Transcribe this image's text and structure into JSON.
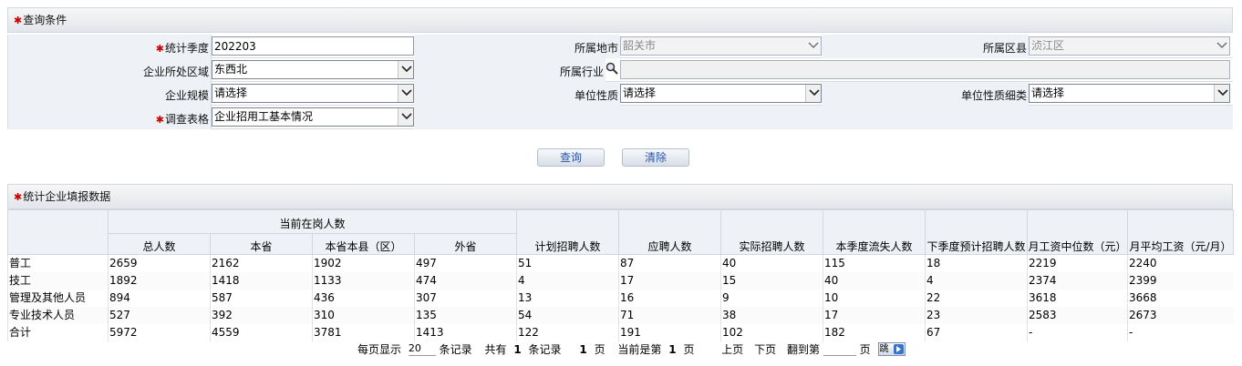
{
  "query": {
    "header": "查询条件",
    "season_label": "统计季度",
    "season_value": "202203",
    "city_label": "所属地市",
    "city_value": "韶关市",
    "county_label": "所属区县",
    "county_value": "浈江区",
    "region_label": "企业所处区域",
    "region_value": "东西北",
    "industry_label": "所属行业",
    "scale_label": "企业规模",
    "scale_value": "请选择",
    "nature_label": "单位性质",
    "nature_value": "请选择",
    "nature_detail_label": "单位性质细类",
    "nature_detail_value": "请选择",
    "survey_label": "调查表格",
    "survey_value": "企业招用工基本情况"
  },
  "buttons": {
    "query": "查询",
    "clear": "清除"
  },
  "results": {
    "header": "统计企业填报数据",
    "group_header": "当前在岗人数",
    "columns": [
      "总人数",
      "本省",
      "本省本县（区）",
      "外省",
      "计划招聘人数",
      "应聘人数",
      "实际招聘人数",
      "本季度流失人数",
      "下季度预计招聘人数",
      "月工资中位数（元）",
      "月平均工资（元/月）"
    ],
    "rows": [
      [
        "普工",
        "2659",
        "2162",
        "1902",
        "497",
        "51",
        "87",
        "40",
        "115",
        "18",
        "2219",
        "2240"
      ],
      [
        "技工",
        "1892",
        "1418",
        "1133",
        "474",
        "4",
        "17",
        "15",
        "40",
        "4",
        "2374",
        "2399"
      ],
      [
        "管理及其他人员",
        "894",
        "587",
        "436",
        "307",
        "13",
        "16",
        "9",
        "10",
        "22",
        "3618",
        "3668"
      ],
      [
        "专业技术人员",
        "527",
        "392",
        "310",
        "135",
        "54",
        "71",
        "38",
        "17",
        "23",
        "2583",
        "2673"
      ],
      [
        "合计",
        "5972",
        "4559",
        "3781",
        "1413",
        "122",
        "191",
        "102",
        "182",
        "67",
        "-",
        "-"
      ]
    ]
  },
  "pager": {
    "per_page_label": "每页显示",
    "per_page_value": "20",
    "records_suffix": "条记录",
    "total_prefix": "共有",
    "total_count": "1",
    "total_suffix": "条记录",
    "pages_count": "1",
    "pages_suffix": "页",
    "current_prefix": "当前是第",
    "current_page": "1",
    "current_suffix": "页",
    "prev": "上页",
    "next": "下页",
    "goto_prefix": "翻到第",
    "goto_suffix": "页",
    "go_button": "跳"
  }
}
